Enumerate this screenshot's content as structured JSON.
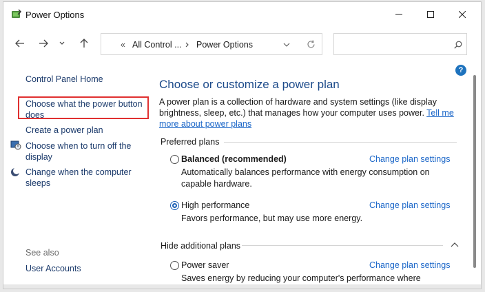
{
  "window": {
    "title": "Power Options"
  },
  "address": {
    "overflow": "«",
    "crumb1": "All Control ...",
    "crumb2": "Power Options"
  },
  "search": {
    "placeholder": ""
  },
  "help_icon": "?",
  "sidebar": {
    "home": "Control Panel Home",
    "links": [
      "Choose what the power button does",
      "Create a power plan",
      "Choose when to turn off the display",
      "Change when the computer sleeps"
    ],
    "see_also": "See also",
    "user_accounts": "User Accounts"
  },
  "main": {
    "heading": "Choose or customize a power plan",
    "description": "A power plan is a collection of hardware and system settings (like display brightness, sleep, etc.) that manages how your computer uses power. ",
    "tell_more": "Tell me more about power plans",
    "preferred_label": "Preferred plans",
    "hide_label": "Hide additional plans",
    "plans": [
      {
        "name": "Balanced (recommended)",
        "link": "Change plan settings",
        "desc": "Automatically balances performance with energy consumption on capable hardware.",
        "selected": false
      },
      {
        "name": "High performance",
        "link": "Change plan settings",
        "desc": "Favors performance, but may use more energy.",
        "selected": true
      },
      {
        "name": "Power saver",
        "link": "Change plan settings",
        "desc": "Saves energy by reducing your computer's performance where possible.",
        "selected": false
      }
    ]
  },
  "colors": {
    "link": "#1a66c8",
    "heading": "#1c4a8a",
    "highlight": "#e03030"
  }
}
